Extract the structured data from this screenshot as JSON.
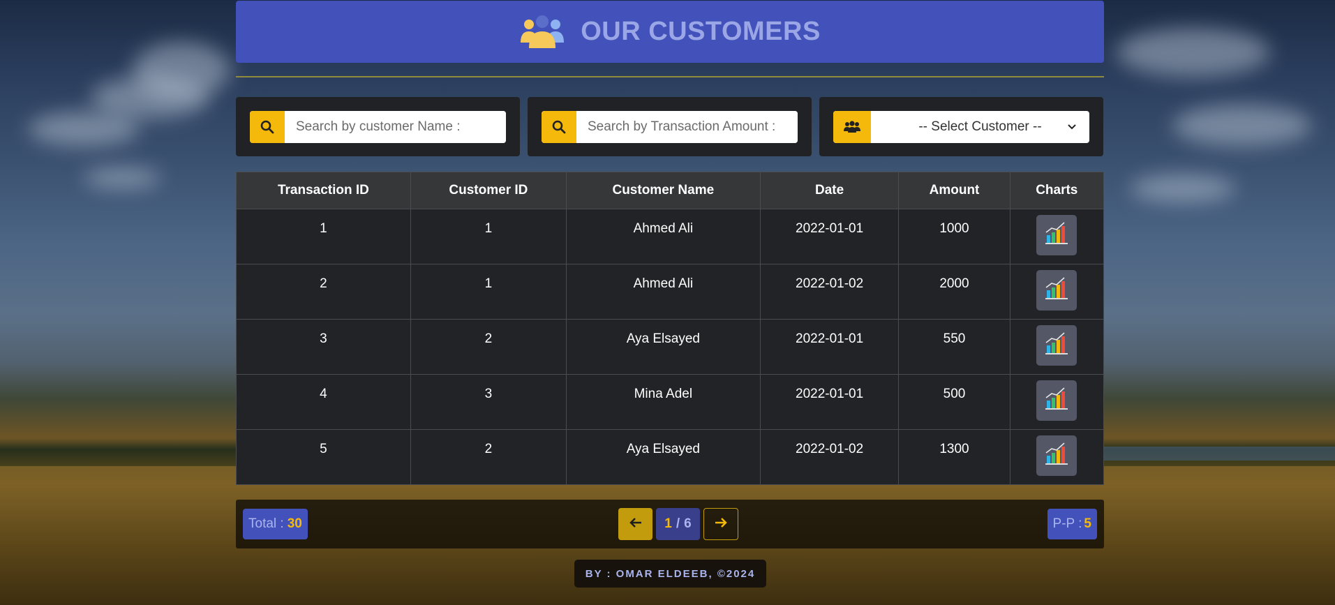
{
  "header": {
    "title": "OUR CUSTOMERS",
    "icon": "users-icon"
  },
  "filters": {
    "name_placeholder": "Search by customer Name :",
    "amount_placeholder": "Search by Transaction Amount :",
    "select_label": "-- Select Customer --",
    "icons": [
      "search-icon",
      "search-icon",
      "users-icon",
      "chevron-down-icon"
    ]
  },
  "table": {
    "headers": [
      "Transaction ID",
      "Customer ID",
      "Customer Name",
      "Date",
      "Amount",
      "Charts"
    ],
    "rows": [
      {
        "transaction_id": "1",
        "customer_id": "1",
        "customer_name": "Ahmed Ali",
        "date": "2022-01-01",
        "amount": "1000"
      },
      {
        "transaction_id": "2",
        "customer_id": "1",
        "customer_name": "Ahmed Ali",
        "date": "2022-01-02",
        "amount": "2000"
      },
      {
        "transaction_id": "3",
        "customer_id": "2",
        "customer_name": "Aya Elsayed",
        "date": "2022-01-01",
        "amount": "550"
      },
      {
        "transaction_id": "4",
        "customer_id": "3",
        "customer_name": "Mina Adel",
        "date": "2022-01-01",
        "amount": "500"
      },
      {
        "transaction_id": "5",
        "customer_id": "2",
        "customer_name": "Aya Elsayed",
        "date": "2022-01-02",
        "amount": "1300"
      }
    ],
    "row_action_icon": "chart-icon"
  },
  "footer": {
    "total_label": "Total :",
    "total_value": "30",
    "page_current": "1",
    "page_separator": "/",
    "page_total": "6",
    "per_page_label": "P-P :",
    "per_page_value": "5",
    "prev_icon": "arrow-left-icon",
    "next_icon": "arrow-right-icon"
  },
  "credit": "BY : OMAR ELDEEB, ©2024",
  "colors": {
    "accent_blue": "#4352bb",
    "accent_yellow": "#f5b90c",
    "table_bg": "#212327",
    "header_text": "#9aa6e6"
  }
}
